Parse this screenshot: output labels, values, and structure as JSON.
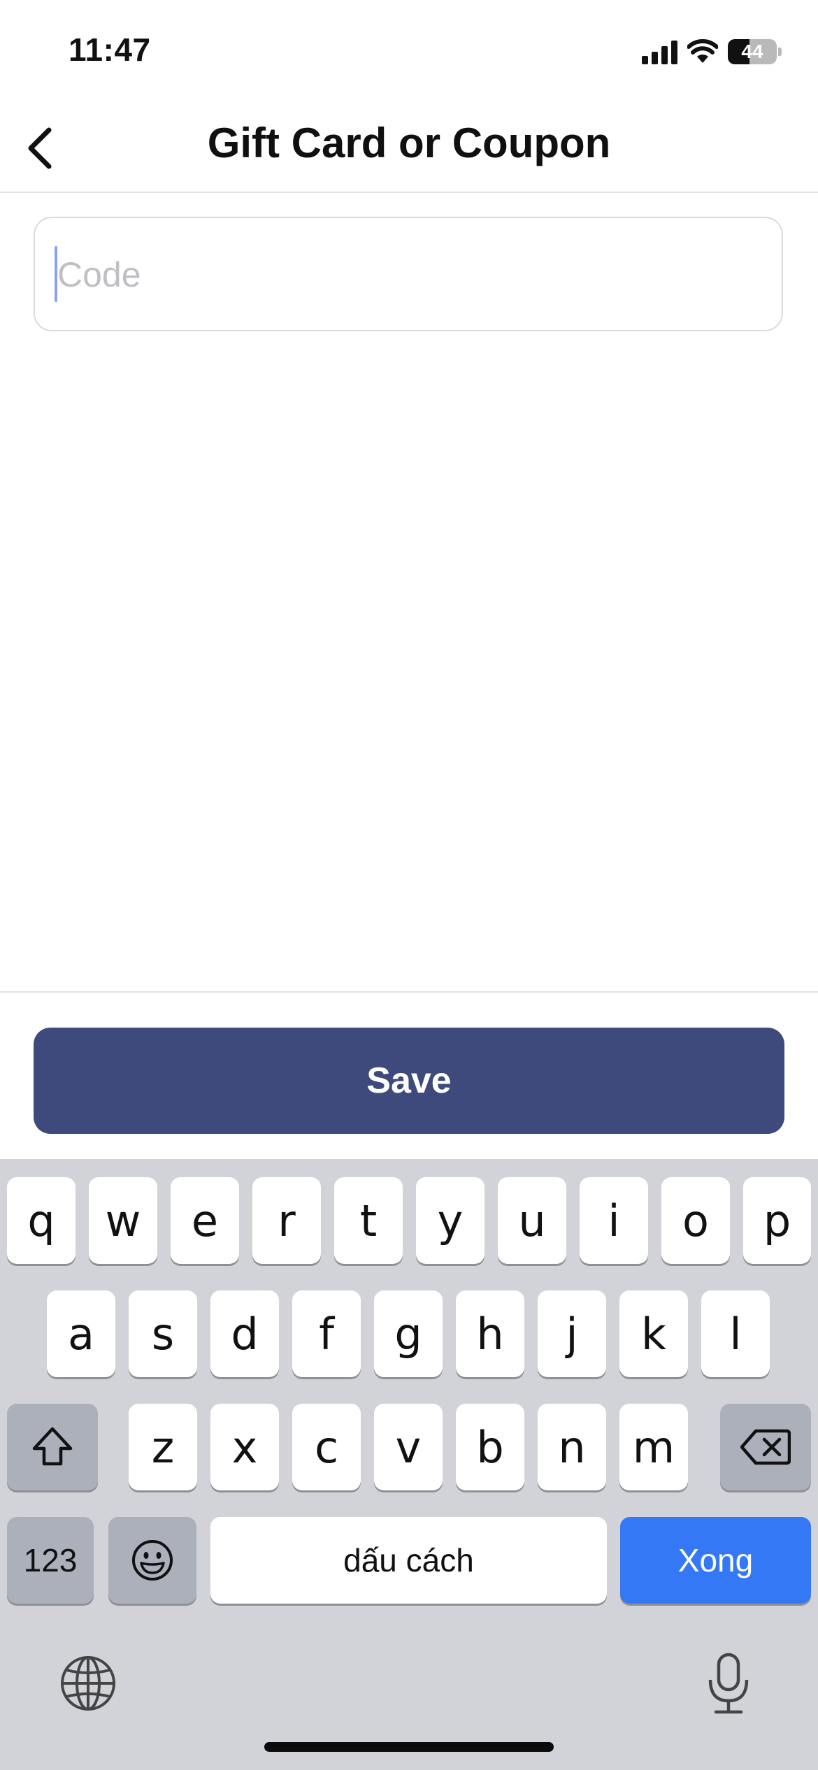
{
  "status_bar": {
    "time": "11:47",
    "battery": "44",
    "battery_level": 0.44
  },
  "nav": {
    "title": "Gift Card or Coupon",
    "back_icon": "chevron-left-icon"
  },
  "code_field": {
    "placeholder": "Code",
    "value": ""
  },
  "save_button": {
    "label": "Save",
    "color": "#3d4a7b"
  },
  "keyboard": {
    "row1": [
      "q",
      "w",
      "e",
      "r",
      "t",
      "y",
      "u",
      "i",
      "o",
      "p"
    ],
    "row2": [
      "a",
      "s",
      "d",
      "f",
      "g",
      "h",
      "j",
      "k",
      "l"
    ],
    "row3": [
      "z",
      "x",
      "c",
      "v",
      "b",
      "n",
      "m"
    ],
    "numbers_key": "123",
    "space_key": "dấu cách",
    "done_key": "Xong",
    "icons": [
      "shift-icon",
      "backspace-icon",
      "emoji-icon",
      "globe-icon",
      "microphone-icon"
    ]
  }
}
